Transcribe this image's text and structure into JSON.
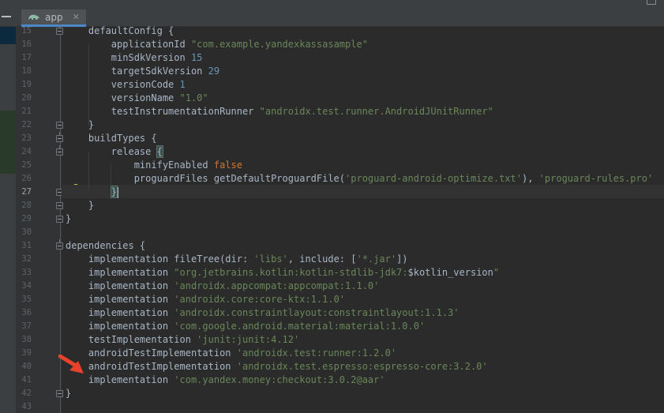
{
  "tab": {
    "label": "app",
    "close_glyph": "✕",
    "icon": "gradle-elephant-icon"
  },
  "gutter": {
    "line_numbers": [
      "15",
      "16",
      "17",
      "18",
      "19",
      "20",
      "21",
      "22",
      "23",
      "24",
      "25",
      "26",
      "27",
      "28",
      "29",
      "30",
      "31",
      "32",
      "33",
      "34",
      "35",
      "36",
      "37",
      "38",
      "39",
      "40",
      "41",
      "42",
      "43"
    ],
    "current_line": "27"
  },
  "code": {
    "l15": {
      "text": "    defaultConfig {"
    },
    "l16": {
      "key": "        applicationId ",
      "value": "\"com.example.yandexkassasample\""
    },
    "l17": {
      "key": "        minSdkVersion ",
      "value": "15"
    },
    "l18": {
      "key": "        targetSdkVersion ",
      "value": "29"
    },
    "l19": {
      "key": "        versionCode ",
      "value": "1"
    },
    "l20": {
      "key": "        versionName ",
      "value": "\"1.0\""
    },
    "l21": {
      "key": "        testInstrumentationRunner ",
      "value": "\"androidx.test.runner.AndroidJUnitRunner\""
    },
    "l22": {
      "text": "    }"
    },
    "l23": {
      "text": "    buildTypes {"
    },
    "l24": {
      "key": "        release ",
      "brace": "{"
    },
    "l25": {
      "key": "            minifyEnabled ",
      "value": "false"
    },
    "l26": {
      "key": "            proguardFiles getDefaultProguardFile(",
      "arg1": "'proguard-android-optimize.txt'",
      "sep": "), ",
      "arg2": "'proguard-rules.pro'"
    },
    "l27": {
      "indent": "        ",
      "brace": "}"
    },
    "l28": {
      "text": "    }"
    },
    "l29": {
      "text": "}"
    },
    "l30": {
      "text": ""
    },
    "l31": {
      "text": "dependencies {"
    },
    "l32": {
      "a": "    implementation fileTree(",
      "b": "dir: ",
      "c": "'libs'",
      "d": ", ",
      "e": "include: ",
      "f": "[",
      "g": "'*.jar'",
      "h": "])"
    },
    "l33": {
      "key": "    implementation ",
      "value": "\"org.jetbrains.kotlin:kotlin-stdlib-jdk7:",
      "var": "$kotlin_version",
      "end": "\""
    },
    "l34": {
      "key": "    implementation ",
      "value": "'androidx.appcompat:appcompat:1.1.0'"
    },
    "l35": {
      "key": "    implementation ",
      "value": "'androidx.core:core-ktx:1.1.0'"
    },
    "l36": {
      "key": "    implementation ",
      "value": "'androidx.constraintlayout:constraintlayout:1.1.3'"
    },
    "l37": {
      "key": "    implementation ",
      "value": "'com.google.android.material:material:1.0.0'"
    },
    "l38": {
      "key": "    testImplementation ",
      "value": "'junit:junit:4.12'"
    },
    "l39": {
      "key": "    androidTestImplementation ",
      "value": "'androidx.test:runner:1.2.0'"
    },
    "l40": {
      "key": "    androidTestImplementation ",
      "value": "'androidx.test.espresso:espresso-core:3.2.0'"
    },
    "l41": {
      "key": "    implementation ",
      "value": "'com.yandex.money:checkout:3.0.2@aar'"
    },
    "l42": {
      "text": "}"
    },
    "l43": {
      "text": ""
    }
  },
  "colors": {
    "background": "#2b2b2b",
    "gutter": "#313335",
    "string": "#6a8759",
    "number": "#6897bb",
    "keyword": "#cc7832",
    "text": "#a9b7c6",
    "arrow": "#e8412c",
    "bulb": "#f6c342"
  },
  "annotations": {
    "arrow_icon": "red-arrow-icon",
    "intention_icon": "lightbulb-icon"
  }
}
